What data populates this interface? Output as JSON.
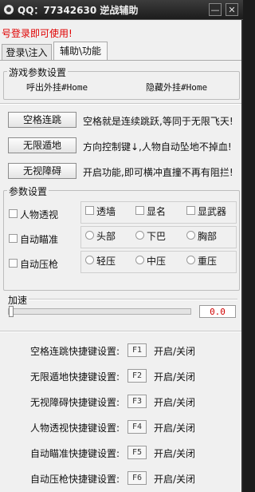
{
  "window": {
    "title": "QQ：77342630 逆战辅助",
    "min_label": "—",
    "close_label": "✕"
  },
  "notice": "号登录即可使用!",
  "tabs": [
    {
      "label": "登录\\注入"
    },
    {
      "label": "辅助\\功能"
    }
  ],
  "game_params": {
    "label": "游戏参数设置",
    "call_hotkey": "呼出外挂#Home",
    "hide_hotkey": "隐藏外挂#Home"
  },
  "features": [
    {
      "button": "空格连跳",
      "desc": "空格就是连续跳跃,等同于无限飞天!"
    },
    {
      "button": "无限遁地",
      "desc": "方向控制键↓,人物自动坠地不掉血!"
    },
    {
      "button": "无视障碍",
      "desc": "开启功能,即可横冲直撞不再有阻拦!"
    }
  ],
  "params": {
    "label": "参数设置",
    "wallhack_label": "人物透视",
    "wallhack_options": [
      "透墙",
      "显名",
      "显武器"
    ],
    "aimbot_label": "自动瞄准",
    "aimbot_options": [
      "头部",
      "下巴",
      "胸部"
    ],
    "recoil_label": "自动压枪",
    "recoil_options": [
      "轻压",
      "中压",
      "重压"
    ]
  },
  "speed": {
    "label": "加速",
    "value": "0.0"
  },
  "hotkeys": [
    {
      "label": "空格连跳快捷键设置:",
      "key": "F1",
      "action": "开启/关闭"
    },
    {
      "label": "无限遁地快捷键设置:",
      "key": "F2",
      "action": "开启/关闭"
    },
    {
      "label": "无视障碍快捷键设置:",
      "key": "F3",
      "action": "开启/关闭"
    },
    {
      "label": "人物透视快捷键设置:",
      "key": "F4",
      "action": "开启/关闭"
    },
    {
      "label": "自动瞄准快捷键设置:",
      "key": "F5",
      "action": "开启/关闭"
    },
    {
      "label": "自动压枪快捷键设置:",
      "key": "F6",
      "action": "开启/关闭"
    }
  ],
  "colors": {
    "notice": "#e00000",
    "value": "#d00000",
    "titlebar": "#1c1c1c"
  }
}
